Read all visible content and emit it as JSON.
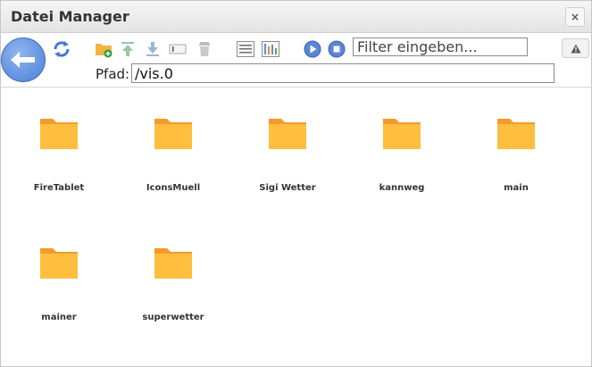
{
  "window": {
    "title": "Datei Manager",
    "close_label": "×"
  },
  "toolbar": {
    "icons": [
      "back-icon",
      "refresh-icon",
      "new-folder-icon",
      "upload-icon",
      "download-icon",
      "rename-icon",
      "delete-icon",
      "list-view-icon",
      "tile-view-icon",
      "play-icon",
      "stop-icon",
      "warning-icon"
    ],
    "filter_placeholder": "Filter eingeben..."
  },
  "path": {
    "label": "Pfad:",
    "value": "/vis.0"
  },
  "folders": [
    {
      "name": "FireTablet"
    },
    {
      "name": "IconsMuell"
    },
    {
      "name": "Sigi Wetter"
    },
    {
      "name": "kannweg"
    },
    {
      "name": "main"
    },
    {
      "name": "mainer"
    },
    {
      "name": "superwetter"
    }
  ],
  "colors": {
    "folder": "#ffbe3d",
    "folder_tab": "#f39a2d",
    "accent_blue": "#4a7fd6"
  }
}
